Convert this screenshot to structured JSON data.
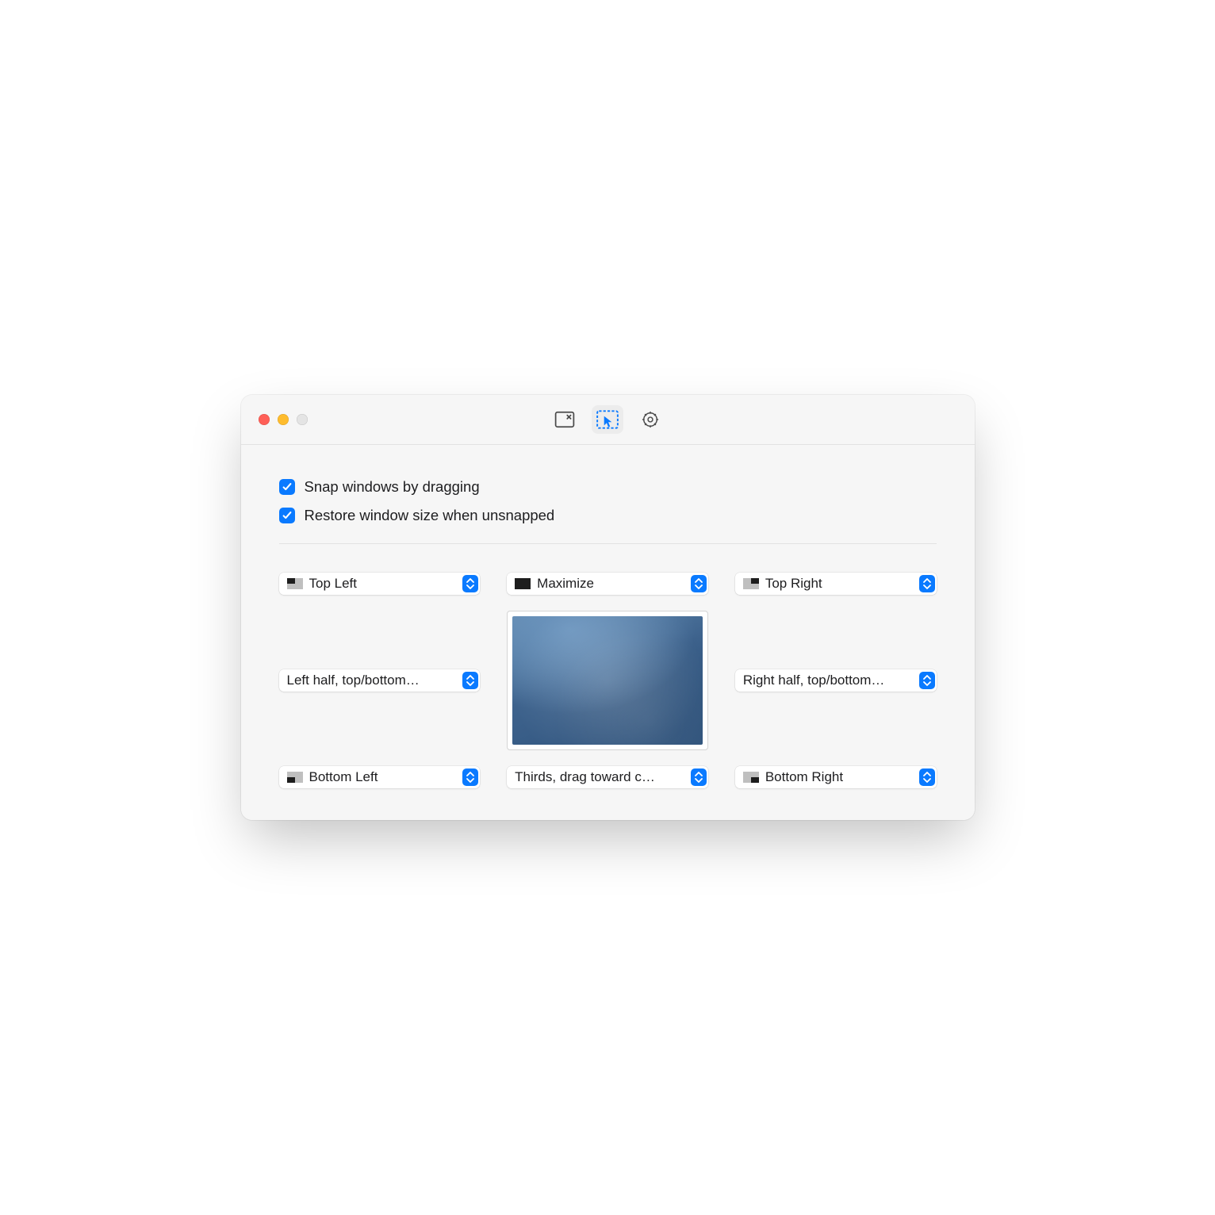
{
  "toolbar": {
    "tabs": [
      {
        "id": "actions",
        "selected": false
      },
      {
        "id": "snap",
        "selected": true
      },
      {
        "id": "settings",
        "selected": false
      }
    ]
  },
  "options": {
    "snap_by_drag": {
      "checked": true,
      "label": "Snap windows by dragging"
    },
    "restore_size": {
      "checked": true,
      "label": "Restore window size when unsnapped"
    }
  },
  "zones": {
    "top_left": {
      "label": "Top Left",
      "glyph": "tl"
    },
    "top_center": {
      "label": "Maximize",
      "glyph": "full"
    },
    "top_right": {
      "label": "Top Right",
      "glyph": "tr"
    },
    "mid_left": {
      "label": "Left half, top/bottom…",
      "glyph": "none"
    },
    "mid_right": {
      "label": "Right half, top/bottom…",
      "glyph": "none"
    },
    "bottom_left": {
      "label": "Bottom Left",
      "glyph": "bl"
    },
    "bottom_center": {
      "label": "Thirds, drag toward c…",
      "glyph": "none"
    },
    "bottom_right": {
      "label": "Bottom Right",
      "glyph": "br"
    }
  }
}
